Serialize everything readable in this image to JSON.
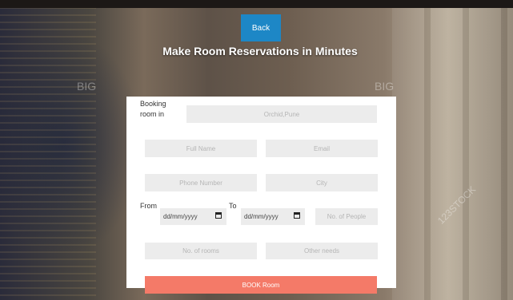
{
  "header": {
    "back_label": "Back",
    "title": "Make Room Reservations in Minutes"
  },
  "form": {
    "booking_label": "Booking room in",
    "hotel_value": "Orchid,Pune",
    "full_name_placeholder": "Full Name",
    "email_placeholder": "Email",
    "phone_placeholder": "Phone Number",
    "city_placeholder": "City",
    "from_label": "From",
    "to_label": "To",
    "from_date": "dd/mm/yyyy",
    "to_date": "dd/mm/yyyy",
    "people_placeholder": "No. of People",
    "rooms_placeholder": "No. of rooms",
    "needs_placeholder": "Other needs",
    "submit_label": "BOOK Room"
  },
  "background": {
    "wall_text_left": "BIG",
    "wall_text_right": "BIG",
    "watermark": "123STOCK"
  }
}
